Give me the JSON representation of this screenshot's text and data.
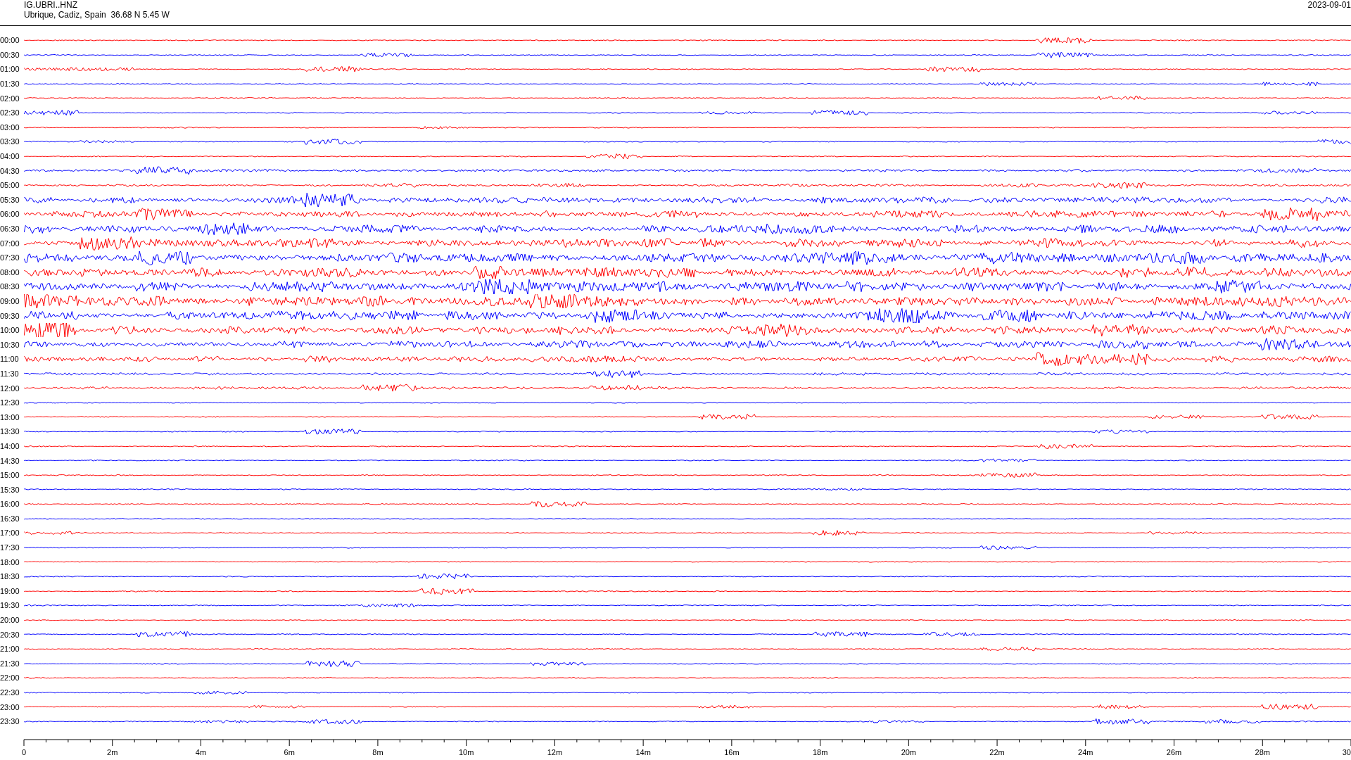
{
  "station": {
    "code": "IG.UBRI..HNZ",
    "location": "Ubrique, Cadiz, Spain  36.68 N 5.45 W"
  },
  "date": "2023-09-01",
  "rows": [
    {
      "time": "00:00",
      "color": "#ff0000"
    },
    {
      "time": "00:30",
      "color": "#0000ff"
    },
    {
      "time": "01:00",
      "color": "#ff0000"
    },
    {
      "time": "01:30",
      "color": "#0000ff"
    },
    {
      "time": "02:00",
      "color": "#ff0000"
    },
    {
      "time": "02:30",
      "color": "#0000ff"
    },
    {
      "time": "03:00",
      "color": "#ff0000"
    },
    {
      "time": "03:30",
      "color": "#0000ff"
    },
    {
      "time": "04:00",
      "color": "#ff0000"
    },
    {
      "time": "04:30",
      "color": "#0000ff"
    },
    {
      "time": "05:00",
      "color": "#ff0000"
    },
    {
      "time": "05:30",
      "color": "#0000ff"
    },
    {
      "time": "06:00",
      "color": "#ff0000"
    },
    {
      "time": "06:30",
      "color": "#0000ff"
    },
    {
      "time": "07:00",
      "color": "#ff0000"
    },
    {
      "time": "07:30",
      "color": "#0000ff"
    },
    {
      "time": "08:00",
      "color": "#ff0000"
    },
    {
      "time": "08:30",
      "color": "#0000ff"
    },
    {
      "time": "09:00",
      "color": "#ff0000"
    },
    {
      "time": "09:30",
      "color": "#0000ff"
    },
    {
      "time": "10:00",
      "color": "#ff0000"
    },
    {
      "time": "10:30",
      "color": "#0000ff"
    },
    {
      "time": "11:00",
      "color": "#ff0000"
    },
    {
      "time": "11:30",
      "color": "#0000ff"
    },
    {
      "time": "12:00",
      "color": "#ff0000"
    },
    {
      "time": "12:30",
      "color": "#0000ff"
    },
    {
      "time": "13:00",
      "color": "#ff0000"
    },
    {
      "time": "13:30",
      "color": "#0000ff"
    },
    {
      "time": "14:00",
      "color": "#ff0000"
    },
    {
      "time": "14:30",
      "color": "#0000ff"
    },
    {
      "time": "15:00",
      "color": "#ff0000"
    },
    {
      "time": "15:30",
      "color": "#0000ff"
    },
    {
      "time": "16:00",
      "color": "#ff0000"
    },
    {
      "time": "16:30",
      "color": "#0000ff"
    },
    {
      "time": "17:00",
      "color": "#ff0000"
    },
    {
      "time": "17:30",
      "color": "#0000ff"
    },
    {
      "time": "18:00",
      "color": "#ff0000"
    },
    {
      "time": "18:30",
      "color": "#0000ff"
    },
    {
      "time": "19:00",
      "color": "#ff0000"
    },
    {
      "time": "19:30",
      "color": "#0000ff"
    },
    {
      "time": "20:00",
      "color": "#ff0000"
    },
    {
      "time": "20:30",
      "color": "#0000ff"
    },
    {
      "time": "21:00",
      "color": "#ff0000"
    },
    {
      "time": "21:30",
      "color": "#0000ff"
    },
    {
      "time": "22:00",
      "color": "#ff0000"
    },
    {
      "time": "22:30",
      "color": "#0000ff"
    },
    {
      "time": "23:00",
      "color": "#ff0000"
    },
    {
      "time": "23:30",
      "color": "#0000ff"
    }
  ],
  "x_axis": {
    "ticks": [
      "0",
      "2m",
      "4m",
      "6m",
      "8m",
      "10m",
      "12m",
      "14m",
      "16m",
      "18m",
      "20m",
      "22m",
      "24m",
      "26m",
      "28m",
      "30"
    ]
  }
}
